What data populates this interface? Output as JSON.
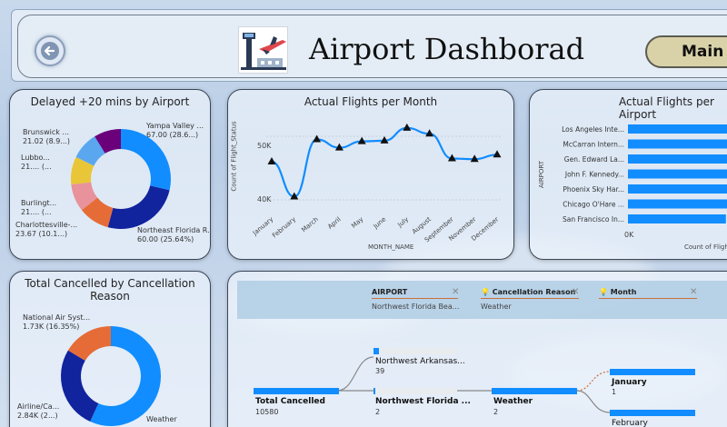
{
  "header": {
    "title": "Airport Dashborad",
    "main_button": "Main",
    "back_icon": "back-arrow-icon",
    "logo_icon": "airport-plane-icon"
  },
  "delayed_card": {
    "title": "Delayed +20 mins by Airport",
    "labels": [
      {
        "line1": "Brunswick ...",
        "line2": "21.02 (8.9...)"
      },
      {
        "line1": "Lubbo...",
        "line2": "21.... (..."
      },
      {
        "line1": "Burlingt...",
        "line2": "21.... (..."
      },
      {
        "line1": "Charlottesville-...",
        "line2": "23.67 (10.1...)"
      },
      {
        "line1": "Yampa Valley ...",
        "line2": "67.00 (28.6...)"
      },
      {
        "line1": "Northeast Florida R...",
        "line2": "60.00 (25.64%)"
      }
    ],
    "slices": [
      {
        "value": 67.0,
        "color": "#118dff"
      },
      {
        "value": 60.0,
        "color": "#12239e"
      },
      {
        "value": 23.67,
        "color": "#e66c37"
      },
      {
        "value": 21.0,
        "color": "#e8929b"
      },
      {
        "value": 21.0,
        "color": "#e8c637"
      },
      {
        "value": 21.02,
        "color": "#5aa7f0"
      },
      {
        "value": 20.6,
        "color": "#6b007b"
      }
    ]
  },
  "flights_month_card": {
    "title": "Actual Flights per Month",
    "ylabel": "Count of Flight_Status",
    "xlabel": "MONTH_NAME",
    "yticks": [
      "50K",
      "40K"
    ]
  },
  "flights_airport_card": {
    "title": "Actual Flights per Airport",
    "ylabel": "AIRPORT",
    "xlabel": "Count of Flight_Status",
    "xtick": "0K"
  },
  "cancel_card": {
    "title": "Total Cancelled by Cancellation Reason",
    "labels": [
      {
        "line1": "National Air Syst...",
        "line2": "1.73K (16.35%)"
      },
      {
        "line1": "Airline/Ca...",
        "line2": "2.84K (2...)"
      },
      {
        "line1": "Weather",
        "line2": ""
      }
    ],
    "slices": [
      {
        "value": 6.01,
        "color": "#118dff"
      },
      {
        "value": 2.84,
        "color": "#12239e"
      },
      {
        "value": 1.73,
        "color": "#e66c37"
      }
    ]
  },
  "decomp": {
    "filters": [
      {
        "name": "AIRPORT",
        "value": "Northwest Florida Bea..."
      },
      {
        "name": "Cancellation Reason",
        "value": "Weather"
      },
      {
        "name": "Month",
        "value": ""
      }
    ],
    "root": {
      "label": "Total Cancelled",
      "value": "10580"
    },
    "airport_nodes": [
      {
        "label": "Northwest Arkansas...",
        "value": "39"
      },
      {
        "label": "Northwest Florida ...",
        "value": "2"
      }
    ],
    "reason_node": {
      "label": "Weather",
      "value": "2"
    },
    "month_nodes": [
      {
        "label": "January",
        "value": "1"
      },
      {
        "label": "February",
        "value": ""
      }
    ]
  },
  "chart_data": [
    {
      "type": "line",
      "title": "Actual Flights per Month",
      "xlabel": "MONTH_NAME",
      "ylabel": "Count of Flight_Status",
      "categories": [
        "January",
        "February",
        "March",
        "April",
        "May",
        "June",
        "July",
        "August",
        "September",
        "November",
        "December"
      ],
      "values": [
        46000,
        40500,
        49500,
        48200,
        49200,
        49300,
        51300,
        50400,
        46500,
        46400,
        47100
      ],
      "ylim": [
        38000,
        53000
      ],
      "yticks": [
        40000,
        50000
      ],
      "grid": true
    },
    {
      "type": "bar",
      "title": "Actual Flights per Airport",
      "categories": [
        "Los Angeles Inte...",
        "McCarran Intern...",
        "Gen. Edward La...",
        "John F. Kennedy...",
        "Phoenix Sky Har...",
        "Chicago O'Hare ...",
        "San Francisco In..."
      ],
      "values": [
        1.0,
        0.98,
        0.96,
        0.92,
        0.83,
        0.83,
        0.77
      ],
      "xlabel": "Count of Flight_Status",
      "ylabel": "AIRPORT"
    },
    {
      "type": "pie",
      "title": "Delayed +20 mins by Airport",
      "categories": [
        "Yampa Valley ...",
        "Northeast Florida R...",
        "Charlottesville-...",
        "Burlingt...",
        "Lubbo...",
        "Brunswick ..."
      ],
      "values": [
        67.0,
        60.0,
        23.67,
        21.0,
        21.0,
        21.02
      ]
    },
    {
      "type": "pie",
      "title": "Total Cancelled by Cancellation Reason",
      "categories": [
        "Weather",
        "Airline/Ca...",
        "National Air Syst..."
      ],
      "values": [
        6.01,
        2.84,
        1.73
      ]
    }
  ]
}
